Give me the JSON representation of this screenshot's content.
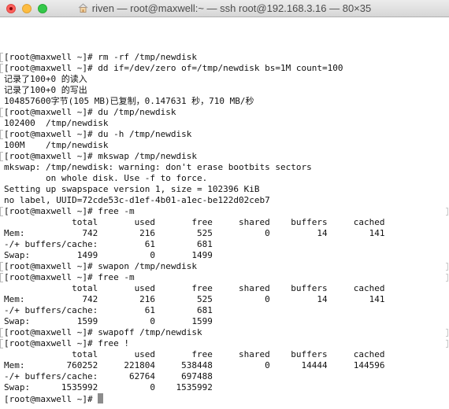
{
  "window": {
    "title": "riven — root@maxwell:~ — ssh root@192.168.3.16 — 80×35",
    "title_icon": "home-icon",
    "buttons": [
      "close",
      "minimize",
      "zoom"
    ]
  },
  "terminal": {
    "prompt": "[root@maxwell ~]# ",
    "lines": [
      "[root@maxwell ~]# rm -rf /tmp/newdisk",
      "[root@maxwell ~]# dd if=/dev/zero of=/tmp/newdisk bs=1M count=100",
      "记录了100+0 的读入",
      "记录了100+0 的写出",
      "104857600字节(105 MB)已复制，0.147631 秒，710 MB/秒",
      "[root@maxwell ~]# du /tmp/newdisk",
      "102400  /tmp/newdisk",
      "[root@maxwell ~]# du -h /tmp/newdisk",
      "100M    /tmp/newdisk",
      "[root@maxwell ~]# mkswap /tmp/newdisk",
      "mkswap: /tmp/newdisk: warning: don't erase bootbits sectors",
      "        on whole disk. Use -f to force.",
      "Setting up swapspace version 1, size = 102396 KiB",
      "no label, UUID=72cde53c-d1ef-4b01-a1ec-be122d02ceb7",
      "[root@maxwell ~]# free -m",
      "             total       used       free     shared    buffers     cached",
      "Mem:           742        216        525          0         14        141",
      "-/+ buffers/cache:         61        681",
      "Swap:         1499          0       1499",
      "[root@maxwell ~]# swapon /tmp/newdisk",
      "[root@maxwell ~]# free -m",
      "             total       used       free     shared    buffers     cached",
      "Mem:           742        216        525          0         14        141",
      "-/+ buffers/cache:         61        681",
      "Swap:         1599          0       1599",
      "[root@maxwell ~]# swapoff /tmp/newdisk",
      "[root@maxwell ~]# free !",
      "             total       used       free     shared    buffers     cached",
      "Mem:        760252     221804     538448          0      14444     144596",
      "-/+ buffers/cache:      62764     697488",
      "Swap:      1535992          0    1535992"
    ],
    "current_prompt": "[root@maxwell ~]# ",
    "marked_lines": [
      0,
      1,
      5,
      7,
      9,
      14,
      19,
      20,
      25,
      26
    ],
    "right_marked_lines": [
      14,
      19,
      20,
      25,
      26
    ]
  }
}
